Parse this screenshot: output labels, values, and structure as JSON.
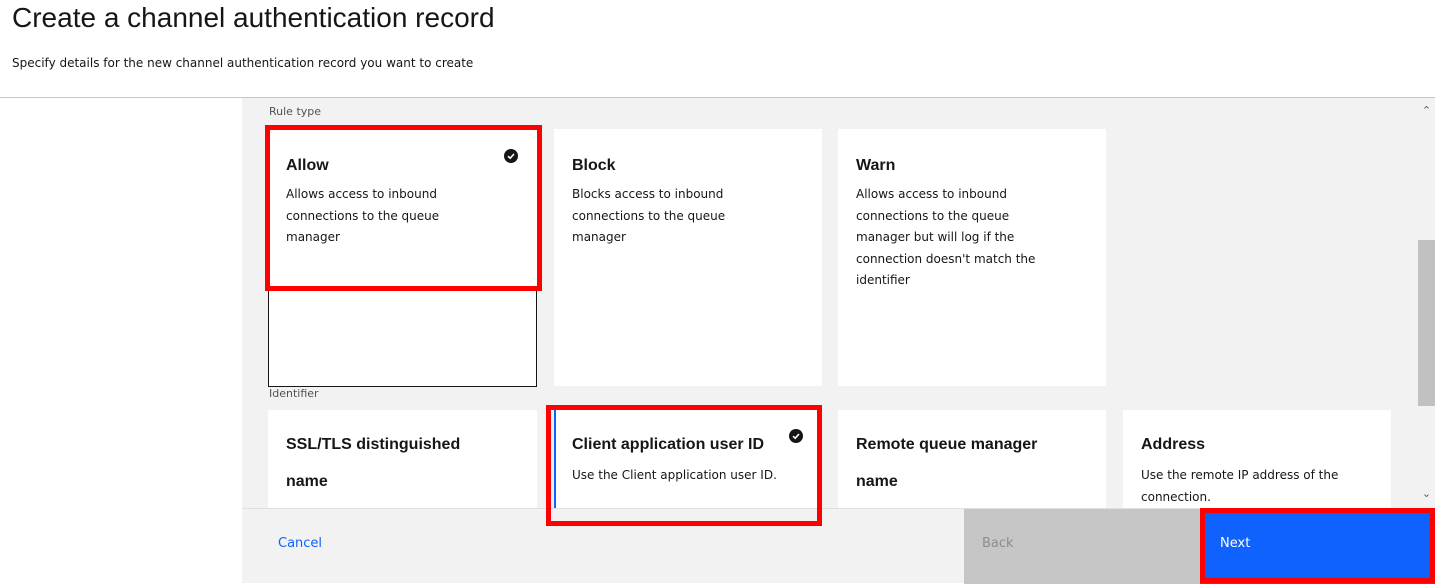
{
  "header": {
    "title": "Create a channel authentication record",
    "subtitle": "Specify details for the new channel authentication record you want to create"
  },
  "rule_type": {
    "label": "Rule type",
    "tiles": [
      {
        "title": "Allow",
        "desc": "Allows access to inbound connections to the queue manager",
        "selected": true
      },
      {
        "title": "Block",
        "desc": "Blocks access to inbound connections to the queue manager",
        "selected": false
      },
      {
        "title": "Warn",
        "desc": "Allows access to inbound connections to the queue manager but will log if the connection doesn't match the identifier",
        "selected": false
      }
    ]
  },
  "identifier": {
    "label": "Identifier",
    "tiles": [
      {
        "title_line1": "SSL/TLS distinguished",
        "title_line2": "name",
        "selected": false
      },
      {
        "title": "Client application user ID",
        "desc": "Use the Client application user ID.",
        "selected": true
      },
      {
        "title_line1": "Remote queue manager",
        "title_line2": "name",
        "selected": false
      },
      {
        "title": "Address",
        "desc": "Use the remote IP address of the connection.",
        "selected": false
      }
    ]
  },
  "footer": {
    "cancel_label": "Cancel",
    "back_label": "Back",
    "next_label": "Next"
  },
  "colors": {
    "highlight": "#ff0000",
    "primary_button": "#0f62fe",
    "disabled_button": "#c6c6c6",
    "link": "#0f62fe"
  },
  "icons": {
    "selected": "checkmark-filled-icon",
    "scroll_up": "chevron-up-icon",
    "scroll_down": "chevron-down-icon"
  }
}
